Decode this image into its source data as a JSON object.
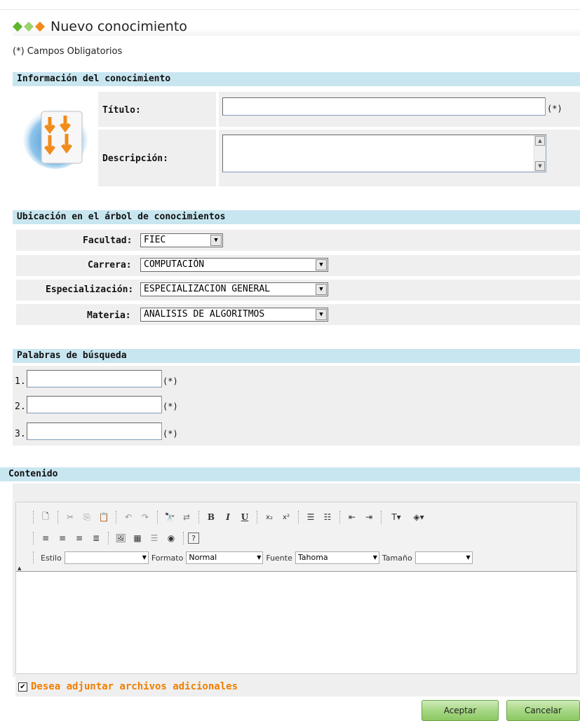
{
  "page": {
    "title": "Nuevo conocimiento",
    "required_note": "(*) Campos Obligatorios",
    "colors": {
      "diamond_green": "#5fb52b",
      "diamond_lightgreen": "#9bd46a",
      "diamond_orange": "#f08b1c",
      "section_bg": "#c8e6f0",
      "accent_orange": "#f07f00"
    }
  },
  "info_section": {
    "header": "Información del conocimiento",
    "icon": "document-arrows-icon",
    "titulo_label": "Título:",
    "titulo_value": "",
    "titulo_req": "(*)",
    "descripcion_label": "Descripción:",
    "descripcion_value": ""
  },
  "location_section": {
    "header": "Ubicación en el árbol de conocimientos",
    "facultad_label": "Facultad:",
    "facultad_value": "FIEC",
    "carrera_label": "Carrera:",
    "carrera_value": "COMPUTACIÓN",
    "especializacion_label": "Especialización:",
    "especializacion_value": "ESPECIALIZACION GENERAL",
    "materia_label": "Materia:",
    "materia_value": "ANALISIS DE ALGORITMOS"
  },
  "keywords_section": {
    "header": "Palabras de búsqueda",
    "items": [
      {
        "num": "1.",
        "value": "",
        "req": "(*)"
      },
      {
        "num": "2.",
        "value": "",
        "req": "(*)"
      },
      {
        "num": "3.",
        "value": "",
        "req": "(*)"
      }
    ]
  },
  "content_section": {
    "header": "Contenido",
    "toolbar": {
      "estilo_label": "Estilo",
      "estilo_value": "",
      "formato_label": "Formato",
      "formato_value": "Normal",
      "fuente_label": "Fuente",
      "fuente_value": "Tahoma",
      "tamano_label": "Tamaño",
      "tamano_value": "",
      "bold": "B",
      "italic": "I",
      "underline": "U",
      "help": "?"
    }
  },
  "attach": {
    "checked": true,
    "label": "Desea adjuntar archivos adicionales"
  },
  "actions": {
    "accept": "Aceptar",
    "cancel": "Cancelar"
  }
}
